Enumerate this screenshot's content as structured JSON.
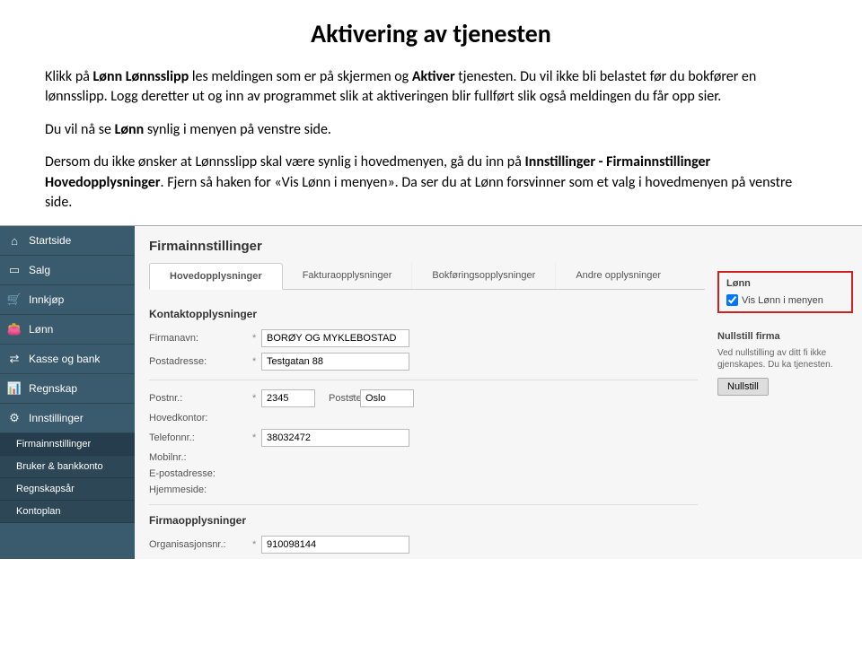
{
  "doc": {
    "title": "Aktivering av tjenesten",
    "p1_a": "Klikk på ",
    "p1_b": "Lønn Lønnsslipp",
    "p1_c": " les meldingen som er på skjermen og ",
    "p1_d": "Aktiver",
    "p1_e": " tjenesten. Du vil ikke bli belastet før du bokfører en lønnsslipp. Logg deretter ut og inn av programmet slik at aktiveringen blir fullført slik også  meldingen du får opp sier.",
    "p2_a": "Du vil nå se ",
    "p2_b": "Lønn",
    "p2_c": " synlig i menyen på venstre side.",
    "p3_a": "Dersom du ikke ønsker at Lønnsslipp skal være synlig i hovedmenyen, gå du inn på ",
    "p3_b": "Innstillinger - Firmainnstillinger Hovedopplysninger",
    "p3_c": ". Fjern så haken for «Vis Lønn i menyen». Da ser du at Lønn forsvinner som et valg i hovedmenyen på venstre side."
  },
  "sidebar": {
    "items": [
      {
        "label": "Startside",
        "icon": "⌂"
      },
      {
        "label": "Salg",
        "icon": "▭"
      },
      {
        "label": "Innkjøp",
        "icon": "🛒"
      },
      {
        "label": "Lønn",
        "icon": "👛"
      },
      {
        "label": "Kasse og bank",
        "icon": "⇄"
      },
      {
        "label": "Regnskap",
        "icon": "📊"
      },
      {
        "label": "Innstillinger",
        "icon": "⚙"
      }
    ],
    "subs": [
      {
        "label": "Firmainnstillinger"
      },
      {
        "label": "Bruker & bankkonto"
      },
      {
        "label": "Regnskapsår"
      },
      {
        "label": "Kontoplan"
      }
    ]
  },
  "main": {
    "pageTitle": "Firmainnstillinger",
    "tabs": [
      {
        "label": "Hovedopplysninger",
        "active": true
      },
      {
        "label": "Fakturaopplysninger"
      },
      {
        "label": "Bokføringsopplysninger"
      },
      {
        "label": "Andre opplysninger"
      }
    ],
    "section1": "Kontaktopplysninger",
    "fields": {
      "firmanavn": {
        "label": "Firmanavn:",
        "value": "BORØY OG MYKLEBOSTAD"
      },
      "postadresse": {
        "label": "Postadresse:",
        "value": "Testgatan 88"
      },
      "postnr": {
        "label": "Postnr.:",
        "value": "2345"
      },
      "poststedLabel": "Poststed:",
      "poststed": {
        "value": "Oslo"
      },
      "hovedkontor": {
        "label": "Hovedkontor:"
      },
      "telefonnr": {
        "label": "Telefonnr.:",
        "value": "38032472"
      },
      "mobilnr": {
        "label": "Mobilnr.:"
      },
      "epost": {
        "label": "E-postadresse:"
      },
      "hjemmeside": {
        "label": "Hjemmeside:"
      }
    },
    "section2": "Firmaopplysninger",
    "orgnr": {
      "label": "Organisasjonsnr.:",
      "value": "910098144"
    }
  },
  "right": {
    "lonTitle": "Lønn",
    "lonCheck": "Vis Lønn i menyen",
    "nullTitle": "Nullstill firma",
    "nullText": "Ved nullstilling av ditt fi ikke gjenskapes. Du ka tjenesten.",
    "nullBtn": "Nullstill"
  }
}
